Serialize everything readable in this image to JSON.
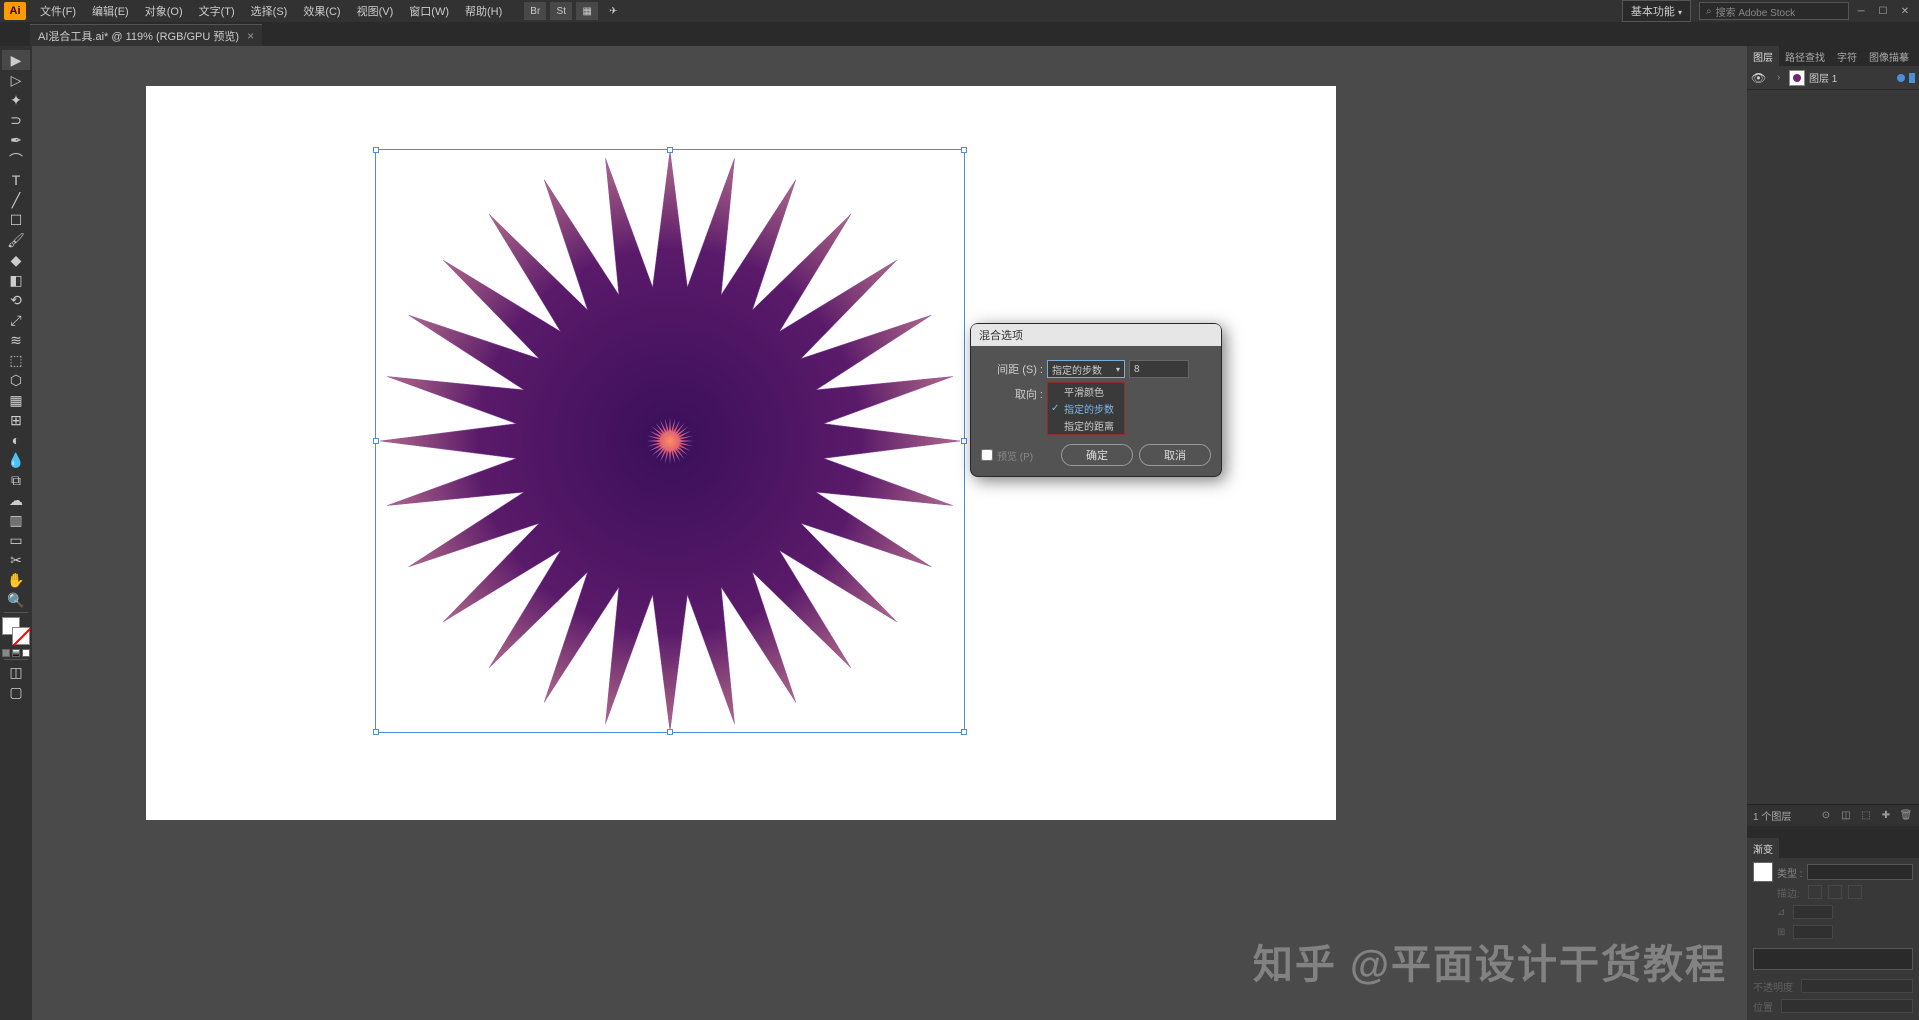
{
  "menubar": {
    "items": [
      "文件(F)",
      "编辑(E)",
      "对象(O)",
      "文字(T)",
      "选择(S)",
      "效果(C)",
      "视图(V)",
      "窗口(W)",
      "帮助(H)"
    ],
    "workspace": "基本功能",
    "search_placeholder": "搜索 Adobe Stock",
    "br_label": "Br",
    "st_label": "St"
  },
  "document": {
    "tab_title": "AI混合工具.ai* @ 119% (RGB/GPU 预览)",
    "close": "×"
  },
  "dialog": {
    "title": "混合选项",
    "spacing_label": "间距 (S) :",
    "spacing_select": "指定的步数",
    "spacing_value": "8",
    "orient_label": "取向 :",
    "dropdown_items": [
      "平滑颜色",
      "指定的步数",
      "指定的距离"
    ],
    "preview_label": "预览 (P)",
    "ok": "确定",
    "cancel": "取消"
  },
  "layers": {
    "tabs": [
      "图层",
      "路径查找",
      "字符",
      "图像描摹"
    ],
    "layer1_name": "图层 1",
    "footer_text": "1 个图层"
  },
  "gradient": {
    "tab": "渐变",
    "type_label": "类型 :",
    "angle_label": "角度",
    "opacity_label": "不透明度",
    "location_label": "位置"
  },
  "watermark": "知乎 @平面设计干货教程"
}
